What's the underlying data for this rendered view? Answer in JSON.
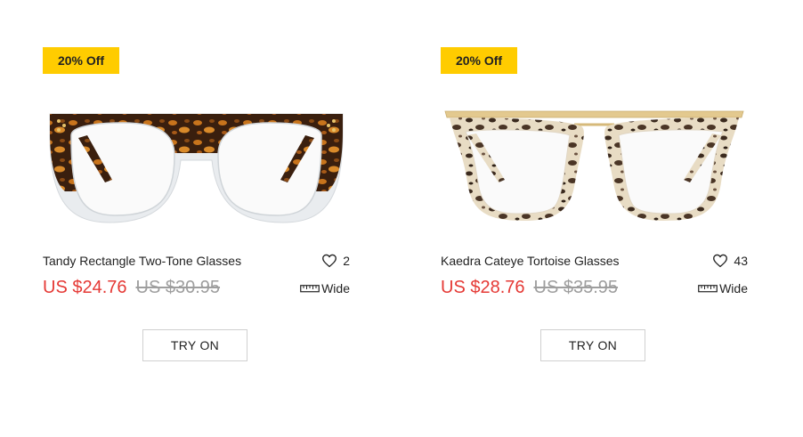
{
  "products": [
    {
      "badge": "20% Off",
      "name": "Tandy Rectangle Two-Tone Glasses",
      "likes": "2",
      "sale_price": "US $24.76",
      "original_price": "US $30.95",
      "fit": "Wide",
      "try_on_label": "TRY ON",
      "image_icon": "glasses-tortoise-two-tone"
    },
    {
      "badge": "20% Off",
      "name": "Kaedra Cateye Tortoise Glasses",
      "likes": "43",
      "sale_price": "US $28.76",
      "original_price": "US $35.95",
      "fit": "Wide",
      "try_on_label": "TRY ON",
      "image_icon": "glasses-cateye-tortoise"
    }
  ],
  "colors": {
    "badge_bg": "#ffcc00",
    "sale_price": "#e53935",
    "original_price": "#9e9e9e"
  }
}
